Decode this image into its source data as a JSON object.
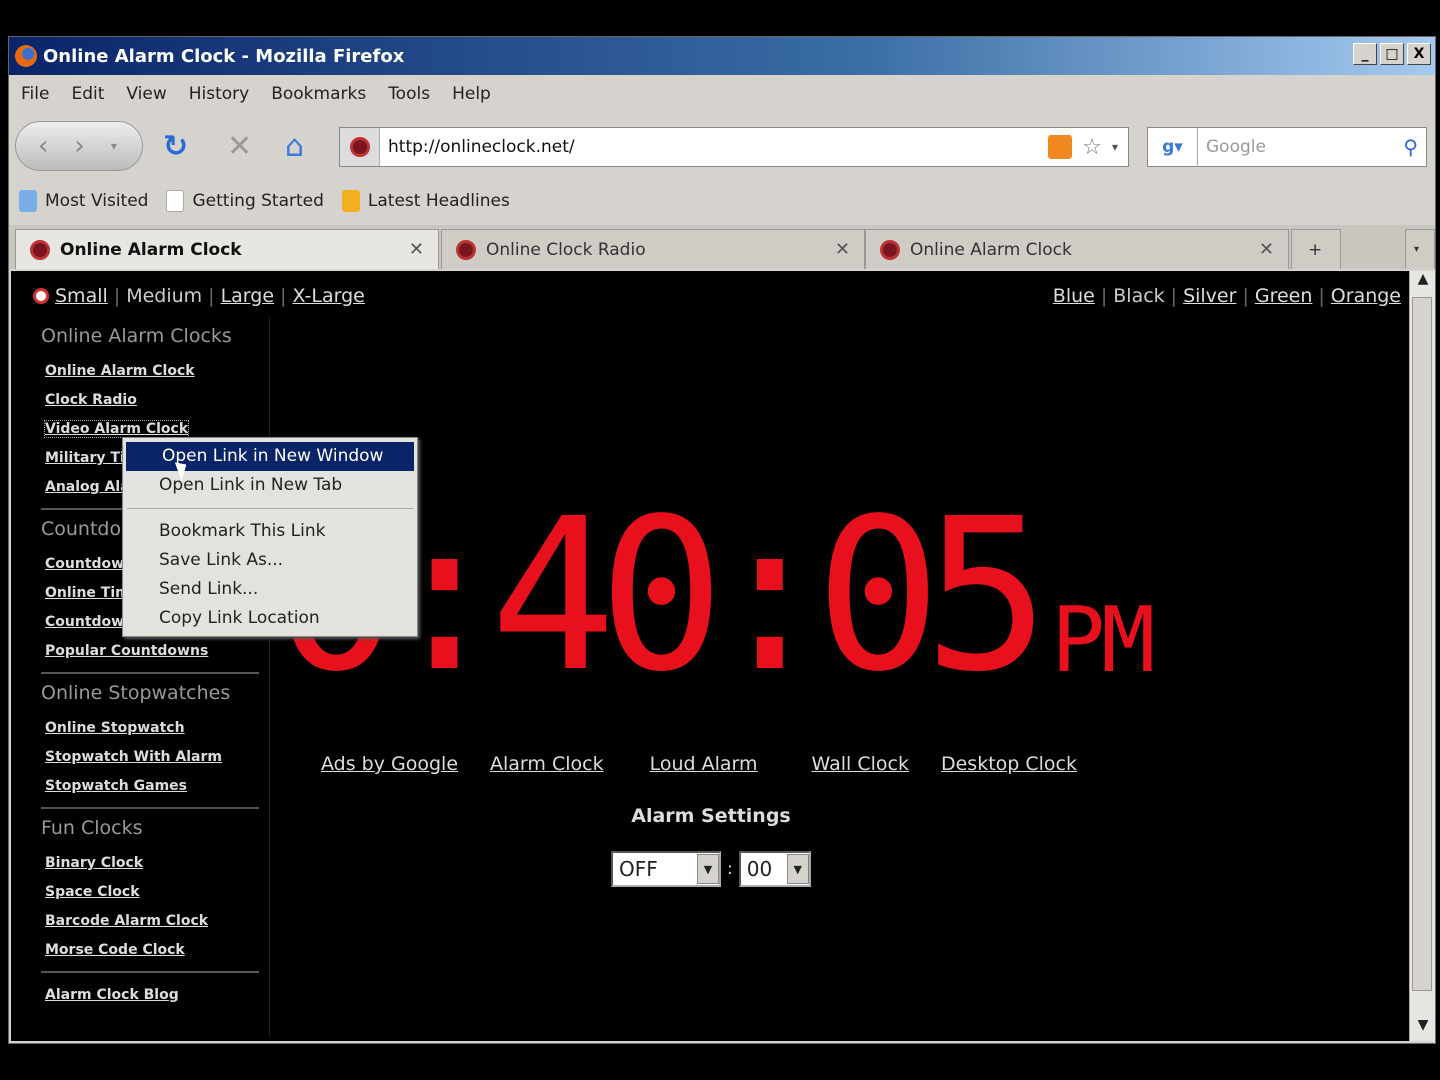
{
  "window": {
    "title": "Online Alarm Clock - Mozilla Firefox",
    "controls": [
      "_",
      "□",
      "X"
    ]
  },
  "menu": [
    "File",
    "Edit",
    "View",
    "History",
    "Bookmarks",
    "Tools",
    "Help"
  ],
  "nav": {
    "url": "http://onlineclock.net/",
    "search_placeholder": "Google"
  },
  "bookmarks": [
    "Most Visited",
    "Getting Started",
    "Latest Headlines"
  ],
  "tabs": [
    {
      "label": "Online Alarm Clock",
      "active": true
    },
    {
      "label": "Online Clock Radio"
    },
    {
      "label": "Online Alarm Clock"
    }
  ],
  "page": {
    "sizes": [
      "Small",
      "Medium",
      "Large",
      "X-Large"
    ],
    "colors": [
      "Blue",
      "Black",
      "Silver",
      "Green",
      "Orange"
    ],
    "sidebar": [
      {
        "heading": "Online Alarm Clocks",
        "links": [
          "Online Alarm Clock",
          "Clock Radio",
          "Video Alarm Clock",
          "Military Time",
          "Analog Alarm Clock"
        ]
      },
      {
        "heading": "Countdowns",
        "links": [
          "Countdown Timer",
          "Online Timer",
          "Countdown Widgets",
          "Popular Countdowns"
        ]
      },
      {
        "heading": "Online Stopwatches",
        "links": [
          "Online Stopwatch",
          "Stopwatch With Alarm",
          "Stopwatch Games"
        ]
      },
      {
        "heading": "Fun Clocks",
        "links": [
          "Binary Clock",
          "Space Clock",
          "Barcode Alarm Clock",
          "Morse Code Clock"
        ]
      },
      {
        "heading": "",
        "links": [
          "Alarm Clock Blog"
        ]
      }
    ],
    "clock": {
      "time": "0:40:05",
      "ampm": "pm",
      "color": "#e8101c"
    },
    "ads": [
      "Ads by Google",
      "Alarm Clock",
      "Loud Alarm",
      "Wall Clock",
      "Desktop Clock"
    ],
    "alarm": {
      "label": "Alarm Settings",
      "hour": "OFF",
      "minute": "00",
      "sep": ":"
    }
  },
  "context_menu": {
    "items": [
      "Open Link in New Window",
      "Open Link in New Tab",
      "Bookmark This Link",
      "Save Link As...",
      "Send Link...",
      "Copy Link Location"
    ]
  }
}
